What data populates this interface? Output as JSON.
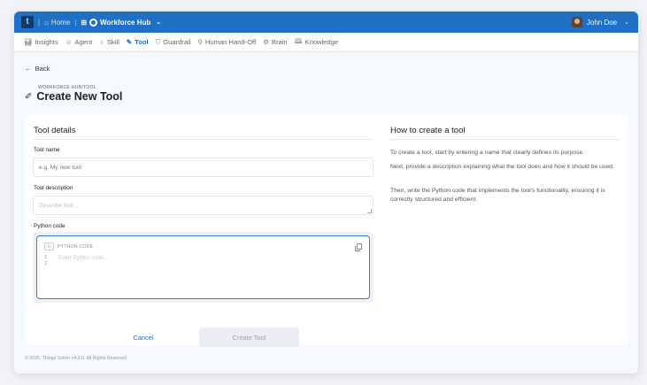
{
  "topbar": {
    "logo_letter": "t",
    "home_label": "Home",
    "workspace_label": "Workforce Hub",
    "user_name": "John Doe"
  },
  "tabs": [
    {
      "label": "Insights",
      "icon": "chart-icon",
      "active": false
    },
    {
      "label": "Agent",
      "icon": "agent-icon",
      "active": false
    },
    {
      "label": "Skill",
      "icon": "skill-icon",
      "active": false
    },
    {
      "label": "Tool",
      "icon": "tool-icon",
      "active": true
    },
    {
      "label": "Guardrail",
      "icon": "shield-icon",
      "active": false
    },
    {
      "label": "Human Hand-Off",
      "icon": "handoff-icon",
      "active": false
    },
    {
      "label": "Brain",
      "icon": "brain-icon",
      "active": false
    },
    {
      "label": "Knowledge",
      "icon": "book-icon",
      "active": false
    }
  ],
  "header": {
    "back_label": "Back",
    "breadcrumb": "WORKFORCE HUB/TOOL",
    "title": "Create New Tool"
  },
  "form": {
    "section_title": "Tool details",
    "name_label": "Tool name",
    "name_placeholder": "e.g. My new tool",
    "name_value": "",
    "description_label": "Tool description",
    "description_placeholder": "Describe tool...",
    "description_value": "",
    "code_label": "Python code",
    "code_header": "PYTHON CODE",
    "code_lines": [
      "1",
      "2"
    ],
    "code_placeholder": "Enter Python code...",
    "cancel_label": "Cancel",
    "create_label": "Create Tool"
  },
  "help": {
    "title": "How to create a tool",
    "paragraphs": [
      "To create a tool, start by entering a name that clearly defines its purpose.",
      "Next, provide a description explaining what the tool does and how it should be used.",
      "Then, write the Python code that implements the tool's functionality, ensuring it is correctly structured and efficient."
    ]
  },
  "footer": {
    "text": "© 2025. Things Solver v4.3.0. All Rights Reserved"
  },
  "colors": {
    "brand": "#1f6fc4",
    "active_tab": "#1f6fc4",
    "disabled_button": "#eceef1"
  }
}
